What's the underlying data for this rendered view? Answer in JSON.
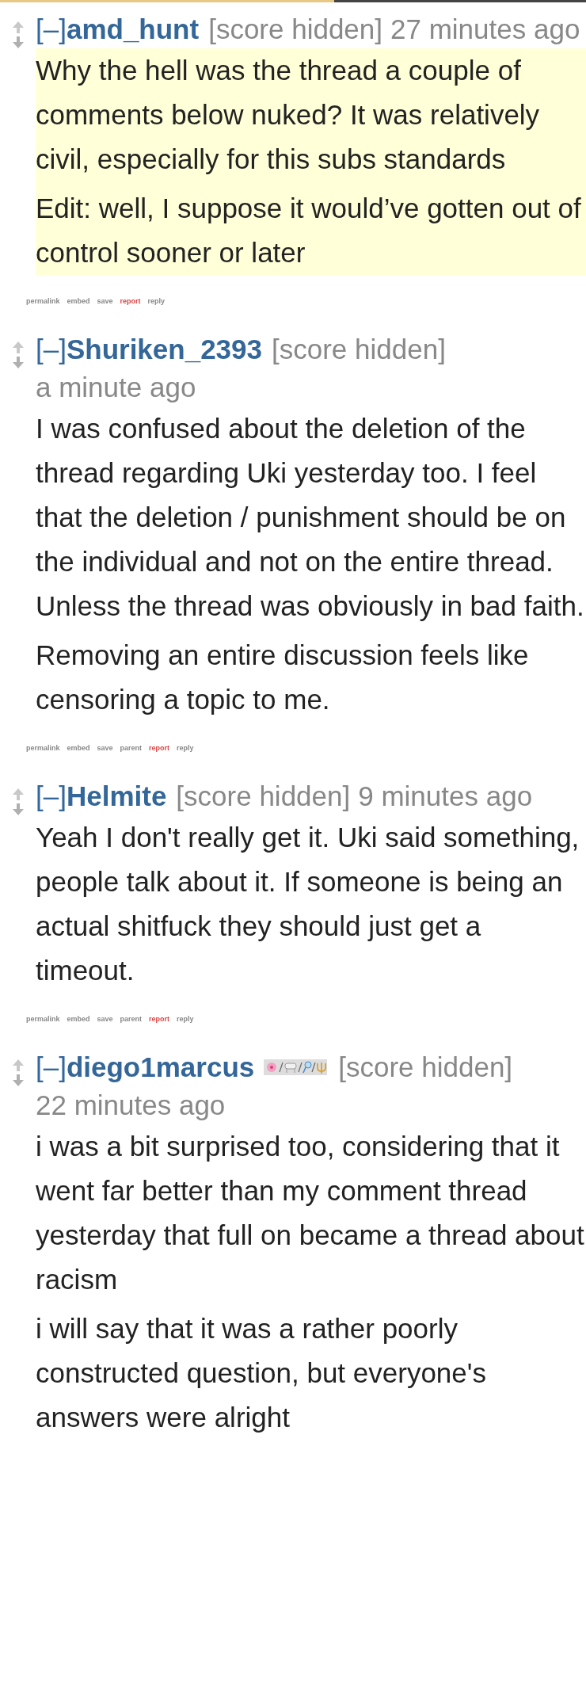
{
  "comments": [
    {
      "toggle": "[–]",
      "author": "amd_hunt",
      "flair": false,
      "score": "[score hidden]",
      "time": "27 minutes ago",
      "highlighted": true,
      "paragraphs": [
        "Why the hell was the thread a couple of comments below nuked? It was relatively civil, especially for this subs standards",
        "Edit: well, I suppose it would’ve gotten out of control sooner or later"
      ],
      "links": [
        {
          "label": "permalink",
          "kind": "normal"
        },
        {
          "label": "embed",
          "kind": "normal"
        },
        {
          "label": "save",
          "kind": "normal"
        },
        {
          "label": "report",
          "kind": "report"
        },
        {
          "label": "reply",
          "kind": "normal"
        }
      ]
    },
    {
      "toggle": "[–]",
      "author": "Shuriken_2393",
      "flair": false,
      "score": "[score hidden]",
      "time": "a minute ago",
      "highlighted": false,
      "paragraphs": [
        "I was confused about the deletion of the thread regarding Uki yesterday too. I feel that the deletion / punishment should be on the individual and not on the entire thread. Unless the thread was obviously in bad faith.",
        "Removing an entire discussion feels like censoring a topic to me."
      ],
      "links": [
        {
          "label": "permalink",
          "kind": "normal"
        },
        {
          "label": "embed",
          "kind": "normal"
        },
        {
          "label": "save",
          "kind": "normal"
        },
        {
          "label": "parent",
          "kind": "normal"
        },
        {
          "label": "report",
          "kind": "report"
        },
        {
          "label": "reply",
          "kind": "normal"
        }
      ]
    },
    {
      "toggle": "[–]",
      "author": "Helmite",
      "flair": false,
      "score": "[score hidden]",
      "time": "9 minutes ago",
      "highlighted": false,
      "paragraphs": [
        "Yeah I don't really get it. Uki said something, people talk about it. If someone is being an actual shitfuck they should just get a timeout."
      ],
      "links": [
        {
          "label": "permalink",
          "kind": "normal"
        },
        {
          "label": "embed",
          "kind": "normal"
        },
        {
          "label": "save",
          "kind": "normal"
        },
        {
          "label": "parent",
          "kind": "normal"
        },
        {
          "label": "report",
          "kind": "report"
        },
        {
          "label": "reply",
          "kind": "normal"
        }
      ]
    },
    {
      "toggle": "[–]",
      "author": "diego1marcus",
      "flair": true,
      "score": "[score hidden]",
      "time": "22 minutes ago",
      "highlighted": false,
      "paragraphs": [
        "i was a bit surprised too, considering that it went far better than my comment thread yesterday that full on became a thread about racism",
        "i will say that it was a rather poorly constructed question, but everyone's answers were alright"
      ]
    }
  ]
}
